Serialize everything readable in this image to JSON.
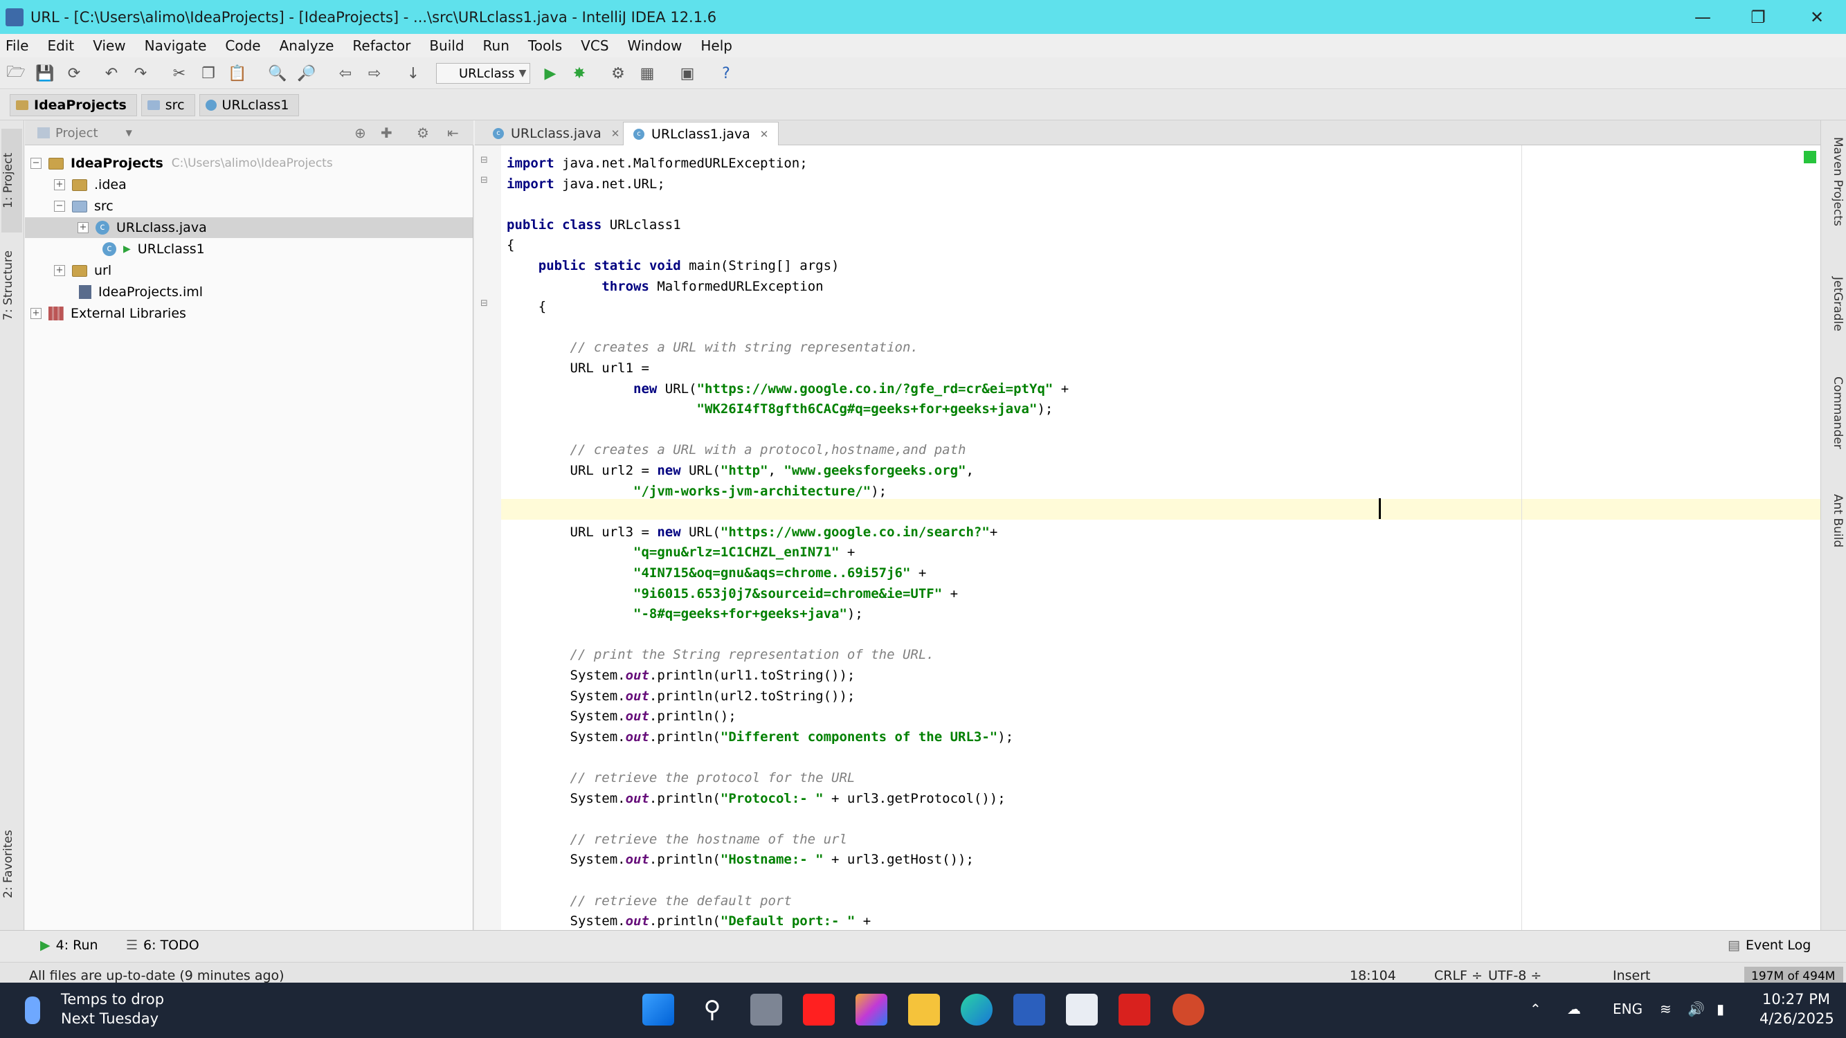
{
  "window": {
    "title": "URL - [C:\\Users\\alimo\\IdeaProjects] - [IdeaProjects] - ...\\src\\URLclass1.java - IntelliJ IDEA 12.1.6",
    "minimize": "—",
    "restore": "❐",
    "close": "✕"
  },
  "menu": [
    "File",
    "Edit",
    "View",
    "Navigate",
    "Code",
    "Analyze",
    "Refactor",
    "Build",
    "Run",
    "Tools",
    "VCS",
    "Window",
    "Help"
  ],
  "toolbar": {
    "run_config": "URLclass"
  },
  "breadcrumbs": [
    "IdeaProjects",
    "src",
    "URLclass1"
  ],
  "left_strip": {
    "project": "1: Project",
    "structure": "7: Structure",
    "favorites": "2: Favorites"
  },
  "project_panel": {
    "header": "Project",
    "tree": [
      {
        "label": "IdeaProjects",
        "path": "C:\\Users\\alimo\\IdeaProjects"
      },
      {
        "label": ".idea"
      },
      {
        "label": "src"
      },
      {
        "label": "URLclass.java"
      },
      {
        "label": "URLclass1"
      },
      {
        "label": "url"
      },
      {
        "label": "IdeaProjects.iml"
      },
      {
        "label": "External Libraries"
      }
    ]
  },
  "editor_tabs": [
    {
      "label": "URLclass.java"
    },
    {
      "label": "URLclass1.java"
    }
  ],
  "code": [
    "import java.net.MalformedURLException;",
    "import java.net.URL;",
    "",
    "public class URLclass1",
    "{",
    "    public static void main(String[] args)",
    "            throws MalformedURLException",
    "    {",
    "",
    "        // creates a URL with string representation.",
    "        URL url1 =",
    "                new URL(\"https://www.google.co.in/?gfe_rd=cr&ei=ptYq\" +",
    "                        \"WK26I4fT8gfth6CACg#q=geeks+for+geeks+java\");",
    "",
    "        // creates a URL with a protocol,hostname,and path",
    "        URL url2 = new URL(\"http\", \"www.geeksforgeeks.org\",",
    "                \"/jvm-works-jvm-architecture/\");",
    "",
    "        URL url3 = new URL(\"https://www.google.co.in/search?\"+",
    "                \"q=gnu&rlz=1C1CHZL_enIN71\" +",
    "                \"4IN715&oq=gnu&aqs=chrome..69i57j6\" +",
    "                \"9i6015.653j0j7&sourceid=chrome&ie=UTF\" +",
    "                \"-8#q=geeks+for+geeks+java\");",
    "",
    "        // print the String representation of the URL.",
    "        System.out.println(url1.toString());",
    "        System.out.println(url2.toString());",
    "        System.out.println();",
    "        System.out.println(\"Different components of the URL3-\");",
    "",
    "        // retrieve the protocol for the URL",
    "        System.out.println(\"Protocol:- \" + url3.getProtocol());",
    "",
    "        // retrieve the hostname of the url",
    "        System.out.println(\"Hostname:- \" + url3.getHost());",
    "",
    "        // retrieve the default port",
    "        System.out.println(\"Default port:- \" +"
  ],
  "right_strip": {
    "maven": "Maven Projects",
    "jetgradle": "JetGradle",
    "commander": "Commander",
    "ant": "Ant Build"
  },
  "tool_windows": {
    "run": "4: Run",
    "todo": "6: TODO",
    "event_log": "Event Log"
  },
  "status": {
    "message": "All files are up-to-date (9 minutes ago)",
    "position": "18:104",
    "line_sep": "CRLF ÷",
    "encoding": "UTF-8 ÷",
    "mode": "Insert",
    "memory": "197M of 494M"
  },
  "taskbar": {
    "weather_title": "Temps to drop",
    "weather_sub": "Next Tuesday",
    "lang": "ENG",
    "time": "10:27 PM",
    "date": "4/26/2025"
  }
}
